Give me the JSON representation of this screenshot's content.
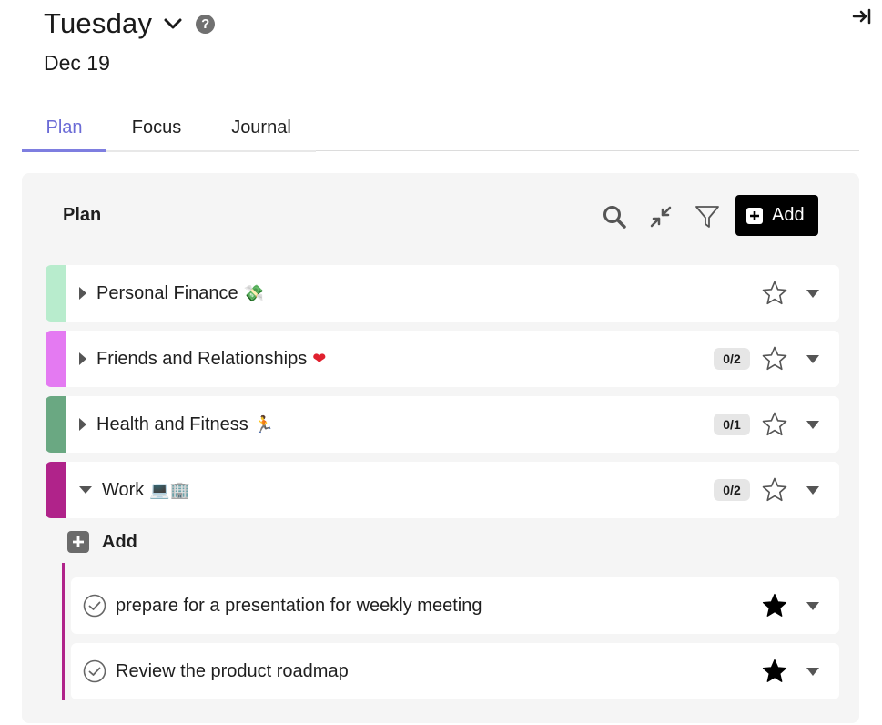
{
  "header": {
    "day": "Tuesday",
    "date": "Dec 19"
  },
  "tabs": [
    {
      "label": "Plan",
      "active": true
    },
    {
      "label": "Focus",
      "active": false
    },
    {
      "label": "Journal",
      "active": false
    }
  ],
  "panel": {
    "title": "Plan",
    "add_label": "Add"
  },
  "categories": [
    {
      "label": "Personal Finance",
      "emoji": "💸",
      "color": "#b8eccd",
      "badge": "",
      "expanded": false
    },
    {
      "label": "Friends and Relationships",
      "emoji": "❤",
      "color": "#e47af2",
      "badge": "0/2",
      "expanded": false
    },
    {
      "label": "Health and Fitness",
      "emoji": "🏃",
      "color": "#6aa882",
      "badge": "0/1",
      "expanded": false
    },
    {
      "label": "Work",
      "emoji": "💻🏢",
      "color": "#b0238a",
      "badge": "0/2",
      "expanded": true
    }
  ],
  "work_add_label": "Add",
  "tasks": [
    {
      "label": "prepare for a presentation for weekly meeting",
      "starred": true
    },
    {
      "label": "Review the product roadmap",
      "starred": true
    }
  ],
  "colors": {
    "accent_tab": "#6b6bd6",
    "work_line": "#b0238a",
    "add_button_bg": "#000000"
  }
}
